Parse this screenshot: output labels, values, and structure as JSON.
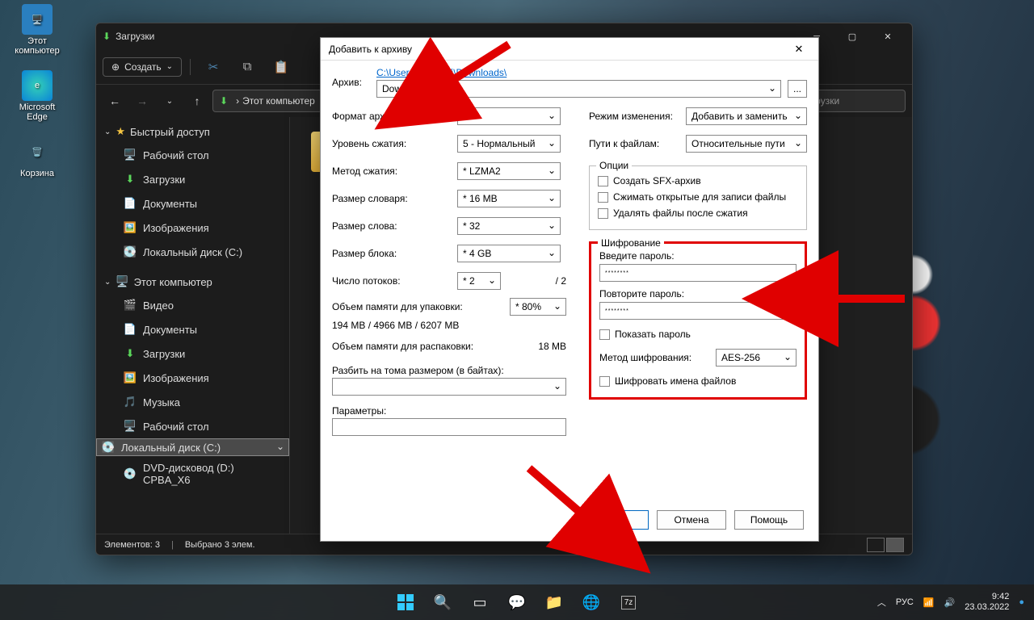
{
  "desktop": {
    "icons": [
      {
        "label": "Этот\nкомпьютер",
        "glyph": "🖥️",
        "bg": "#2a7fbf"
      },
      {
        "label": "Microsoft\nEdge",
        "glyph": "🌐",
        "bg": "#0a84d8"
      },
      {
        "label": "Корзина",
        "glyph": "🗑️",
        "bg": "#ddd"
      }
    ]
  },
  "explorer": {
    "title": "Загрузки",
    "new_btn": "Создать",
    "path_prefix": "Этот компьютер",
    "search_placeholder": "Поиск: Загрузки",
    "quick_access": "Быстрый доступ",
    "qa_items": [
      {
        "icon": "🖥️",
        "label": "Рабочий стол",
        "color": "#38a9e0"
      },
      {
        "icon": "⬇",
        "label": "Загрузки",
        "color": "#5bd75b"
      },
      {
        "icon": "📄",
        "label": "Документы",
        "color": "#9aa"
      },
      {
        "icon": "🖼️",
        "label": "Изображения",
        "color": "#3a9"
      },
      {
        "icon": "💽",
        "label": "Локальный диск (C:)",
        "color": "#9aa"
      }
    ],
    "this_pc": "Этот компьютер",
    "pc_items": [
      {
        "icon": "🎬",
        "label": "Видео"
      },
      {
        "icon": "📄",
        "label": "Документы"
      },
      {
        "icon": "⬇",
        "label": "Загрузки"
      },
      {
        "icon": "🖼️",
        "label": "Изображения"
      },
      {
        "icon": "🎵",
        "label": "Музыка"
      },
      {
        "icon": "🖥️",
        "label": "Рабочий стол"
      },
      {
        "icon": "💽",
        "label": "Локальный диск (C:)",
        "sel": true
      },
      {
        "icon": "💿",
        "label": "DVD-дисковод (D:) CPBA_X6"
      }
    ],
    "folder_label": "Д",
    "status_items": "Элементов: 3",
    "status_sel": "Выбрано 3 элем."
  },
  "dlg": {
    "title": "Добавить к архиву",
    "archive_lbl": "Архив:",
    "archive_path": "C:\\Users\\Евгений\\Downloads\\",
    "archive_name": "Downloads.7z",
    "browse": "...",
    "format_lbl": "Формат архива:",
    "format_val": "7z",
    "level_lbl": "Уровень сжатия:",
    "level_val": "5 - Нормальный",
    "method_lbl": "Метод сжатия:",
    "method_val": "* LZMA2",
    "dict_lbl": "Размер словаря:",
    "dict_val": "* 16 MB",
    "word_lbl": "Размер слова:",
    "word_val": "* 32",
    "block_lbl": "Размер блока:",
    "block_val": "* 4 GB",
    "threads_lbl": "Число потоков:",
    "threads_val": "* 2",
    "threads_max": "/ 2",
    "mem_pack_lbl": "Объем памяти для упаковки:",
    "mem_pack_pct": "* 80%",
    "mem_pack_info": "194 MB / 4966 MB / 6207 MB",
    "mem_unpack_lbl": "Объем памяти для распаковки:",
    "mem_unpack_val": "18 MB",
    "split_lbl": "Разбить на тома размером (в байтах):",
    "params_lbl": "Параметры:",
    "update_lbl": "Режим изменения:",
    "update_val": "Добавить и заменить",
    "paths_lbl": "Пути к файлам:",
    "paths_val": "Относительные пути",
    "options_lbl": "Опции",
    "opt_sfx": "Создать SFX-архив",
    "opt_shared": "Сжимать открытые для записи файлы",
    "opt_delete": "Удалять файлы после сжатия",
    "enc_lbl": "Шифрование",
    "enc_pw": "Введите пароль:",
    "enc_pw_val": "********",
    "enc_pw2": "Повторите пароль:",
    "enc_pw2_val": "********",
    "enc_show": "Показать пароль",
    "enc_method_lbl": "Метод шифрования:",
    "enc_method_val": "AES-256",
    "enc_names": "Шифровать имена файлов",
    "btn_ok": "OK",
    "btn_cancel": "Отмена",
    "btn_help": "Помощь"
  },
  "taskbar": {
    "lang": "РУС",
    "time": "9:42",
    "date": "23.03.2022"
  }
}
